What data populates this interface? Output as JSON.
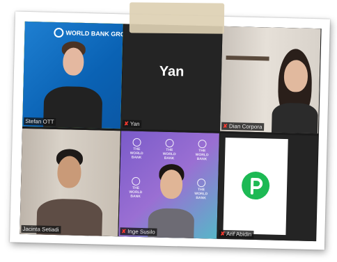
{
  "participants": [
    {
      "name": "Stefan OTT",
      "tile_text": "",
      "muted": false,
      "active_speaker": true
    },
    {
      "name": "Yan",
      "tile_text": "Yan",
      "muted": true,
      "active_speaker": false
    },
    {
      "name": "Dian Corpora",
      "tile_text": "",
      "muted": true,
      "active_speaker": false
    },
    {
      "name": "Jacinta Setiadi",
      "tile_text": "",
      "muted": false,
      "active_speaker": false
    },
    {
      "name": "Inge Susilo",
      "tile_text": "",
      "muted": true,
      "active_speaker": false
    },
    {
      "name": "Arif Abidin",
      "tile_text": "",
      "muted": true,
      "active_speaker": false
    }
  ],
  "backgrounds": {
    "stefan": "WORLD BANK GROUP",
    "inge": "THE WORLD BANK"
  },
  "icons": {
    "muted": "mic-muted-icon"
  },
  "colors": {
    "active_border": "#a7e34a",
    "mute": "#ff3b30",
    "grid_bg": "#1b1b1b"
  }
}
